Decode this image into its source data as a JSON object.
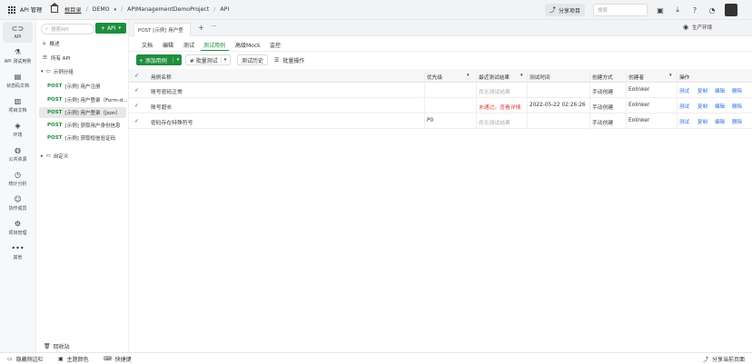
{
  "topbar": {
    "app_name": "API 管理",
    "breadcrumb": [
      "根目录",
      "DEMO",
      "APIManagementDemoProject",
      "API"
    ],
    "share_project": "分享项目",
    "search_placeholder": "搜索"
  },
  "leftnav": [
    {
      "label": "API",
      "icon": "link-icon"
    },
    {
      "label": "API 测试用例",
      "icon": "flask-icon"
    },
    {
      "label": "状态码文档",
      "icon": "document-icon"
    },
    {
      "label": "项目文档",
      "icon": "book-icon"
    },
    {
      "label": "环境",
      "icon": "cube-icon"
    },
    {
      "label": "公共资源",
      "icon": "globe-icon"
    },
    {
      "label": "统计分析",
      "icon": "chart-icon"
    },
    {
      "label": "协作成员",
      "icon": "user-icon"
    },
    {
      "label": "项目管理",
      "icon": "gear-icon"
    },
    {
      "label": "其他",
      "icon": "more-icon"
    }
  ],
  "sidebar": {
    "search_placeholder": "搜索API",
    "add_button": "+ API",
    "overview": "概述",
    "all_api": "所有 API",
    "group": "示例分组",
    "items": [
      {
        "method": "POST",
        "name": "[示例] 用户注册"
      },
      {
        "method": "POST",
        "name": "[示例] 用户登录（Form-d..."
      },
      {
        "method": "POST",
        "name": "[示例] 用户登录（Json）"
      },
      {
        "method": "POST",
        "name": "[示例] 获取用户身份信息"
      },
      {
        "method": "POST",
        "name": "[示例] 获取短信验证码"
      }
    ],
    "custom_group": "自定义",
    "recycle": "回收站"
  },
  "tabbar": {
    "tab_label": "POST [示例] 用户登",
    "env": "生产环境"
  },
  "subtabs": [
    "文档",
    "编辑",
    "测试",
    "测试用例",
    "高级Mock",
    "监控"
  ],
  "toolbar": {
    "add_case": "+ 添加用例",
    "batch_test": "# 批量测试",
    "history": "测试历史",
    "batch_ops": "批量操作"
  },
  "table": {
    "headers": [
      "用例名称",
      "优先级",
      "最近测试结果",
      "测试时间",
      "创建方式",
      "创建者",
      "操作"
    ],
    "rows": [
      {
        "name": "账号密码正常",
        "priority": "",
        "result": "尚无测试结果",
        "result_type": "none",
        "time": "",
        "method": "手动创建",
        "creator": "Eolinker"
      },
      {
        "name": "账号超长",
        "priority": "",
        "result": "未通过，查看详情",
        "result_type": "fail",
        "time": "2022-05-22 02:26:26",
        "method": "手动创建",
        "creator": "Eolinker"
      },
      {
        "name": "密码存在特殊符号",
        "priority": "P0",
        "result": "尚无测试结果",
        "result_type": "none",
        "time": "",
        "method": "手动创建",
        "creator": "Eolinker"
      }
    ],
    "actions": [
      "测试",
      "复制",
      "编辑",
      "删除"
    ]
  },
  "bottombar": {
    "hide_sidebar": "隐藏侧边栏",
    "theme": "主题颜色",
    "shortcuts": "快捷键",
    "share_page": "分享当前页面"
  },
  "colors": {
    "accent": "#1e8e3e",
    "fail": "#e04040",
    "link": "#2a6fdb"
  }
}
